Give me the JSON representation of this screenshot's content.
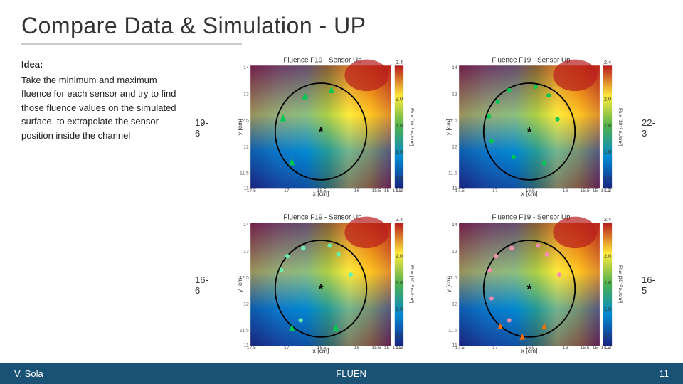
{
  "header": {
    "title": "Compare Data & Simulation - UP",
    "line_width": 310
  },
  "left_panel": {
    "idea_label": "Idea:",
    "description": "Take the minimum and maximum fluence for each sensor and try to find those fluence values on the simulated surface, to extrapolate the sensor position inside the channel"
  },
  "charts": {
    "top_row": [
      {
        "label": "19-6",
        "plot_title": "Fluence F19 - Sensor Up",
        "position": "left"
      },
      {
        "label": "22-3",
        "plot_title": "Fluence F19 - Sensor Up",
        "position": "right"
      }
    ],
    "bottom_row": [
      {
        "label": "16-6",
        "plot_title": "Fluence F19 - Sensor Up",
        "position": "left"
      },
      {
        "label": "16-5",
        "plot_title": "Fluence F19 - Sensor Up",
        "position": "right"
      }
    ]
  },
  "footer": {
    "author": "V. Sola",
    "middle_text": "FLUEN",
    "page_number": "11"
  }
}
